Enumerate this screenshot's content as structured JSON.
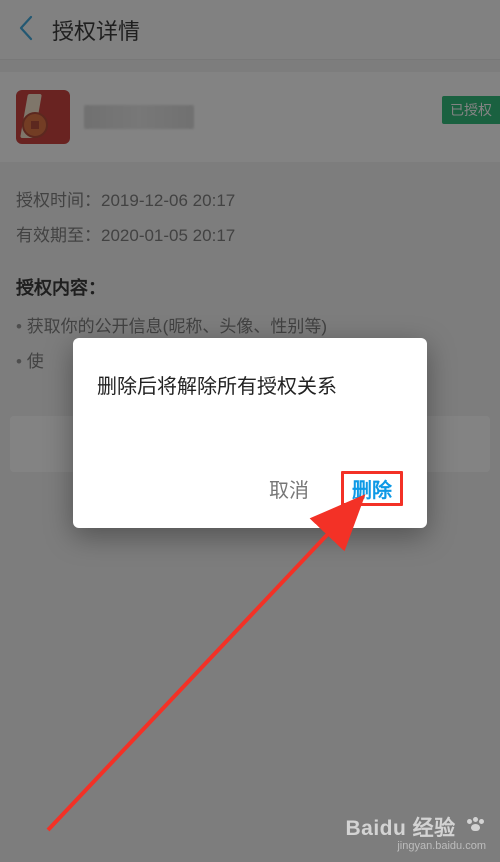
{
  "header": {
    "title": "授权详情"
  },
  "app": {
    "status_badge": "已授权"
  },
  "meta": {
    "auth_time_label": "授权时间：",
    "auth_time_value": "2019-12-06 20:17",
    "valid_until_label": "有效期至：",
    "valid_until_value": "2020-01-05 20:17"
  },
  "content": {
    "title": "授权内容：",
    "items": [
      "获取你的公开信息(昵称、头像、性别等)",
      "使"
    ]
  },
  "dialog": {
    "message": "删除后将解除所有授权关系",
    "cancel": "取消",
    "delete": "删除"
  },
  "watermark": {
    "brand": "Baidu 经验",
    "url": "jingyan.baidu.com"
  }
}
